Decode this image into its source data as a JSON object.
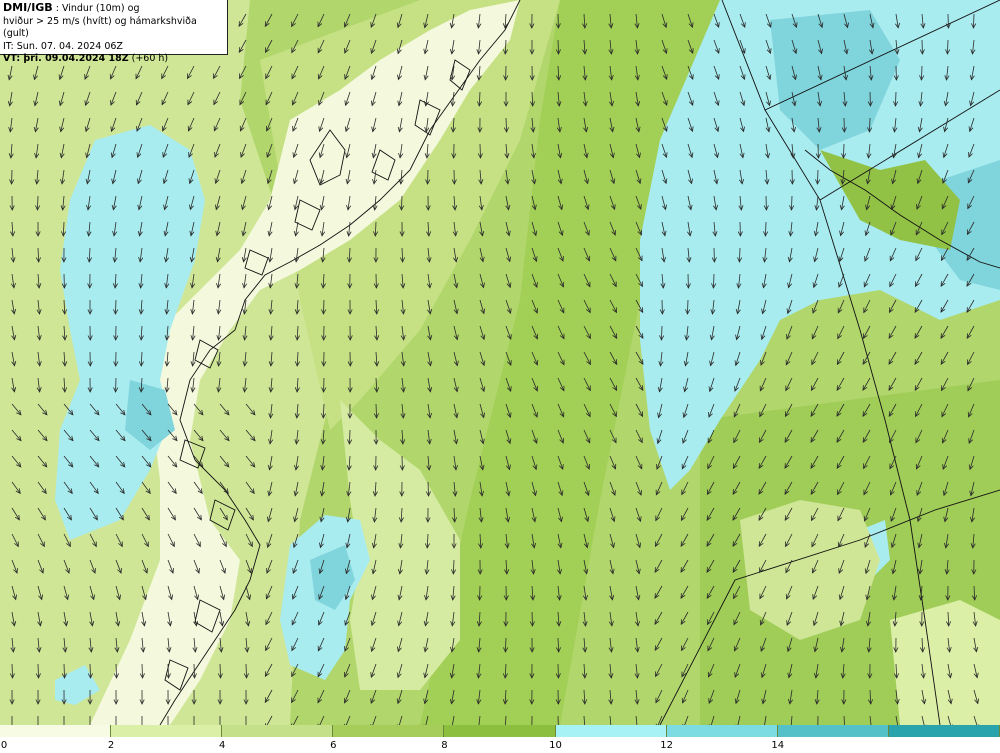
{
  "header": {
    "source": "DMI/IGB",
    "line1_rest": ": Vindur (10m) og",
    "line2": "hviður > 25 m/s (hvítt) og hámarkshviða (gult)",
    "line3": "IT: Sun. 07. 04. 2024 06Z",
    "vt_label": "VT: þri. 09.04.2024 18Z",
    "vt_offset": "(+60 h)"
  },
  "legend": {
    "labels": [
      "0",
      "2",
      "4",
      "6",
      "8",
      "10",
      "12",
      "14"
    ],
    "colors": [
      "#f8fbe4",
      "#dcefa6",
      "#c4e088",
      "#a6cc5a",
      "#8cbf3e",
      "#a6f2f4",
      "#7ddbe2",
      "#54c1c8",
      "#2aa4ac"
    ]
  },
  "map": {
    "colors": {
      "calm": "#f4f8dc",
      "light": "#cfe696",
      "mid": "#b1d66c",
      "strong": "#92c245",
      "cyan_light": "#a9ecf0",
      "cyan_mid": "#80d4dc",
      "coast": "#111111",
      "arrow": "#2a2a2a"
    },
    "arrow_icon": "wind-arrow-icon"
  }
}
